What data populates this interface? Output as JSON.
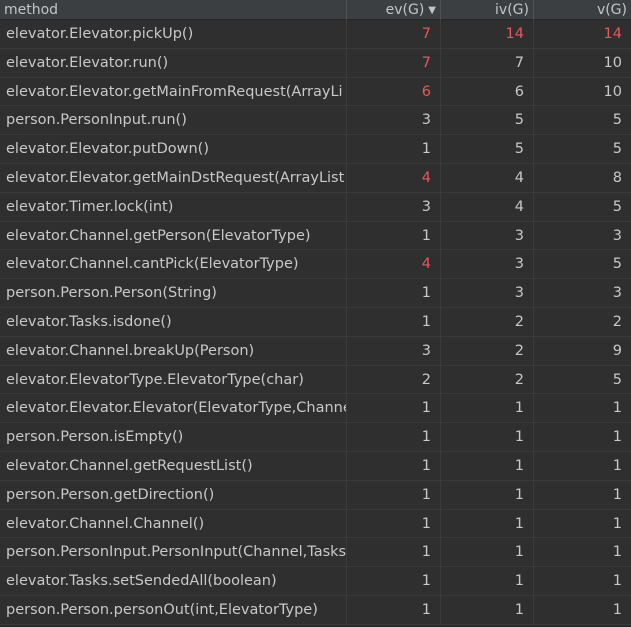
{
  "columns": {
    "method": "method",
    "ev": "ev(G)",
    "iv": "iv(G)",
    "v": "v(G)"
  },
  "sort": {
    "column": "ev",
    "direction": "descending",
    "icon": "sort-desc-icon"
  },
  "colors": {
    "high_value": "#e8575a",
    "normal_value": "#c8c8c8",
    "background": "#2f2f2f",
    "header": "#3c3f41"
  },
  "rows": [
    {
      "method": "elevator.Elevator.pickUp()",
      "ev": "7",
      "iv": "14",
      "v": "14",
      "ev_red": true,
      "iv_red": true,
      "v_red": true
    },
    {
      "method": "elevator.Elevator.run()",
      "ev": "7",
      "iv": "7",
      "v": "10",
      "ev_red": true
    },
    {
      "method": "elevator.Elevator.getMainFromRequest(ArrayLi",
      "ev": "6",
      "iv": "6",
      "v": "10",
      "ev_red": true
    },
    {
      "method": "person.PersonInput.run()",
      "ev": "3",
      "iv": "5",
      "v": "5"
    },
    {
      "method": "elevator.Elevator.putDown()",
      "ev": "1",
      "iv": "5",
      "v": "5"
    },
    {
      "method": "elevator.Elevator.getMainDstRequest(ArrayList",
      "ev": "4",
      "iv": "4",
      "v": "8",
      "ev_red": true
    },
    {
      "method": "elevator.Timer.lock(int)",
      "ev": "3",
      "iv": "4",
      "v": "5"
    },
    {
      "method": "elevator.Channel.getPerson(ElevatorType)",
      "ev": "1",
      "iv": "3",
      "v": "3"
    },
    {
      "method": "elevator.Channel.cantPick(ElevatorType)",
      "ev": "4",
      "iv": "3",
      "v": "5",
      "ev_red": true
    },
    {
      "method": "person.Person.Person(String)",
      "ev": "1",
      "iv": "3",
      "v": "3"
    },
    {
      "method": "elevator.Tasks.isdone()",
      "ev": "1",
      "iv": "2",
      "v": "2"
    },
    {
      "method": "elevator.Channel.breakUp(Person)",
      "ev": "3",
      "iv": "2",
      "v": "9"
    },
    {
      "method": "elevator.ElevatorType.ElevatorType(char)",
      "ev": "2",
      "iv": "2",
      "v": "5"
    },
    {
      "method": "elevator.Elevator.Elevator(ElevatorType,Channe",
      "ev": "1",
      "iv": "1",
      "v": "1"
    },
    {
      "method": "person.Person.isEmpty()",
      "ev": "1",
      "iv": "1",
      "v": "1"
    },
    {
      "method": "elevator.Channel.getRequestList()",
      "ev": "1",
      "iv": "1",
      "v": "1"
    },
    {
      "method": "person.Person.getDirection()",
      "ev": "1",
      "iv": "1",
      "v": "1"
    },
    {
      "method": "elevator.Channel.Channel()",
      "ev": "1",
      "iv": "1",
      "v": "1"
    },
    {
      "method": "person.PersonInput.PersonInput(Channel,Tasks",
      "ev": "1",
      "iv": "1",
      "v": "1"
    },
    {
      "method": "elevator.Tasks.setSendedAll(boolean)",
      "ev": "1",
      "iv": "1",
      "v": "1"
    },
    {
      "method": "person.Person.personOut(int,ElevatorType)",
      "ev": "1",
      "iv": "1",
      "v": "1"
    }
  ]
}
